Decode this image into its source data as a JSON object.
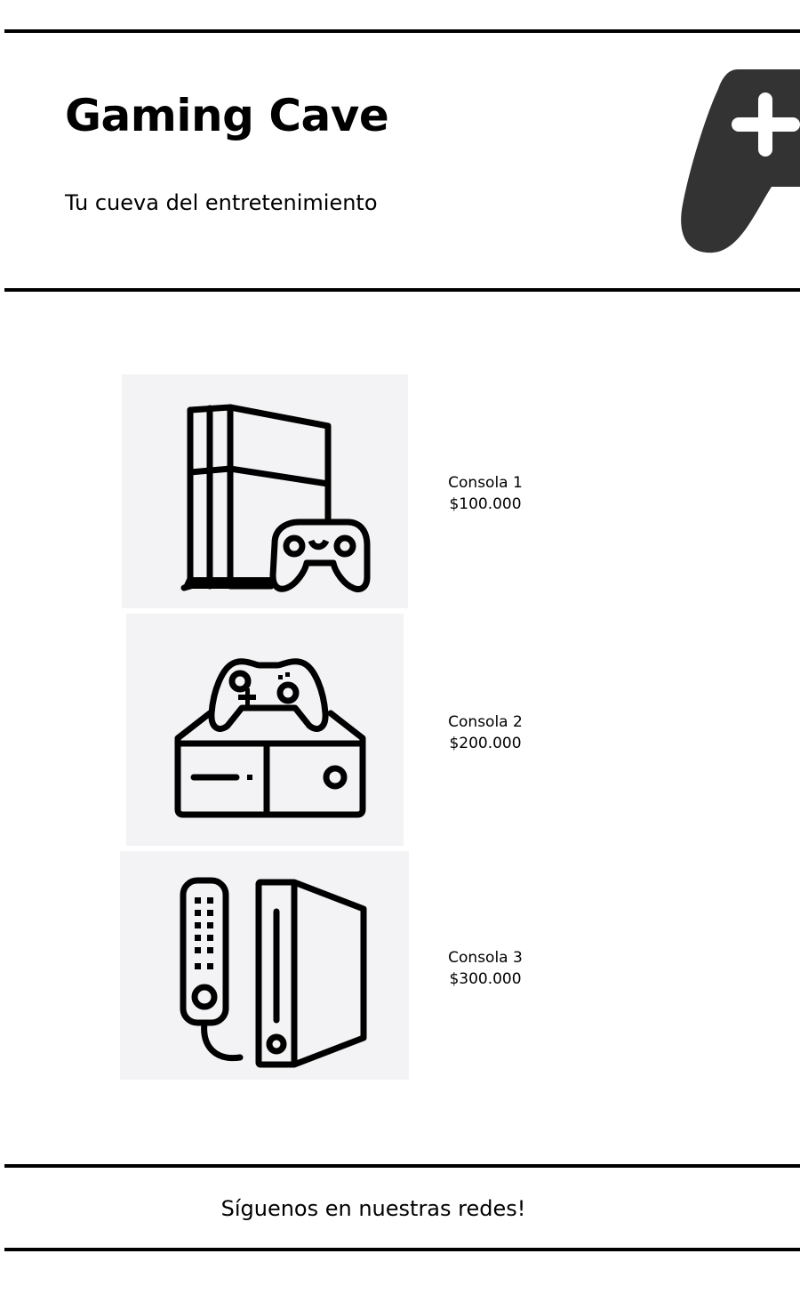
{
  "header": {
    "title": "Gaming Cave",
    "tagline": "Tu cueva del entretenimiento",
    "logo_icon": "gamepad-plus-icon"
  },
  "products": [
    {
      "name": "Consola 1",
      "price": "$100.000",
      "icon": "tower-console-with-controller-icon"
    },
    {
      "name": "Consola 2",
      "price": "$200.000",
      "icon": "box-console-with-controller-icon"
    },
    {
      "name": "Consola 3",
      "price": "$300.000",
      "icon": "remote-and-console-icon"
    }
  ],
  "footer": {
    "text": "Síguenos en nuestras redes!"
  },
  "colors": {
    "rule": "#000000",
    "logo": "#333333",
    "image_background": "#f3f3f5"
  }
}
